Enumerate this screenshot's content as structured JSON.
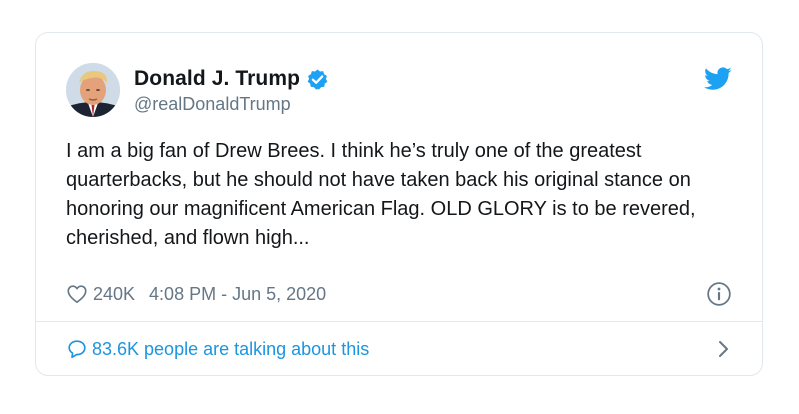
{
  "tweet": {
    "author": {
      "display_name": "Donald J. Trump",
      "handle": "@realDonaldTrump",
      "verified": true
    },
    "text": "I am a big fan of Drew Brees. I think he’s truly one of the greatest quarterbacks, but he should not have taken back his original stance on honoring our magnificent American Flag. OLD GLORY is to be revered, cherished, and flown high...",
    "like_count": "240K",
    "timestamp": "4:08 PM - Jun 5, 2020",
    "conversation_label": "83.6K people are talking about this"
  },
  "icons": {
    "verified": "verified-badge-icon",
    "brand": "twitter-bird-icon",
    "like": "heart-icon",
    "info": "info-icon",
    "reply": "speech-bubble-icon",
    "more": "chevron-right-icon"
  },
  "colors": {
    "accent": "#1da1f2",
    "link": "#1b95e0",
    "muted": "#657786",
    "text": "#14171a",
    "border": "#e1e8ed"
  }
}
